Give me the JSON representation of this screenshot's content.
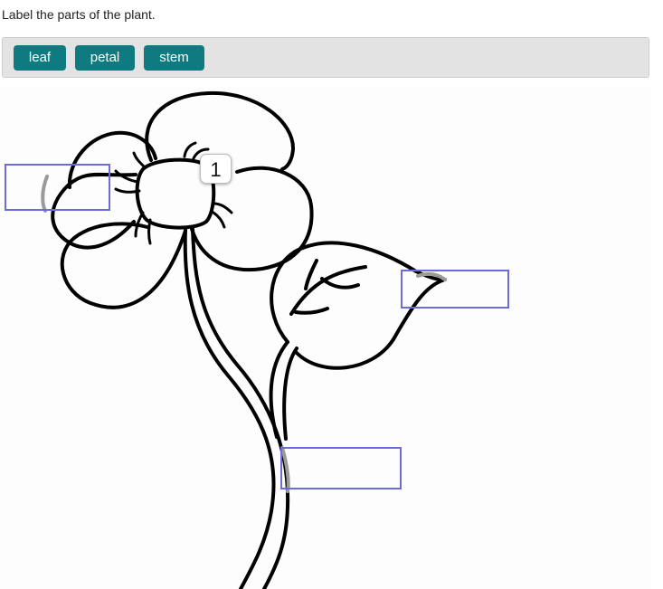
{
  "question": {
    "text": "Label the parts of the plant."
  },
  "word_bank": {
    "accent_color": "#0f7a80",
    "items": [
      {
        "label": "leaf"
      },
      {
        "label": "petal"
      },
      {
        "label": "stem"
      }
    ]
  },
  "drawing": {
    "badge": "1",
    "drop_zone_color": "#6b6bdc"
  }
}
